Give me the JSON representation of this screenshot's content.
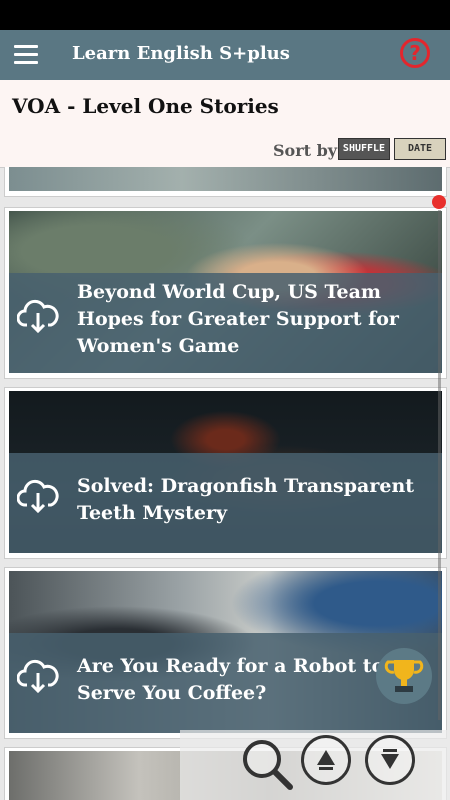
{
  "app": {
    "title": "Learn English S+plus"
  },
  "header": {
    "title": "VOA - Level One Stories",
    "sort_label": "Sort by",
    "shuffle_label": "SHUFFLE",
    "date_label": "DATE"
  },
  "stories": [
    {
      "title": "Beyond World Cup, US Team Hopes for Greater Support for Women's Game"
    },
    {
      "title": "Solved: Dragonfish Transparent Teeth Mystery"
    },
    {
      "title": "Are You Ready for a Robot to Serve You Coffee?"
    }
  ],
  "colors": {
    "appbar": "#5a7783",
    "overlay": "#48606e",
    "help_red": "#e3262d"
  },
  "icons": [
    "menu-icon",
    "help-icon",
    "download-icon",
    "trophy-icon",
    "search-icon",
    "scroll-up-icon",
    "scroll-down-icon"
  ]
}
